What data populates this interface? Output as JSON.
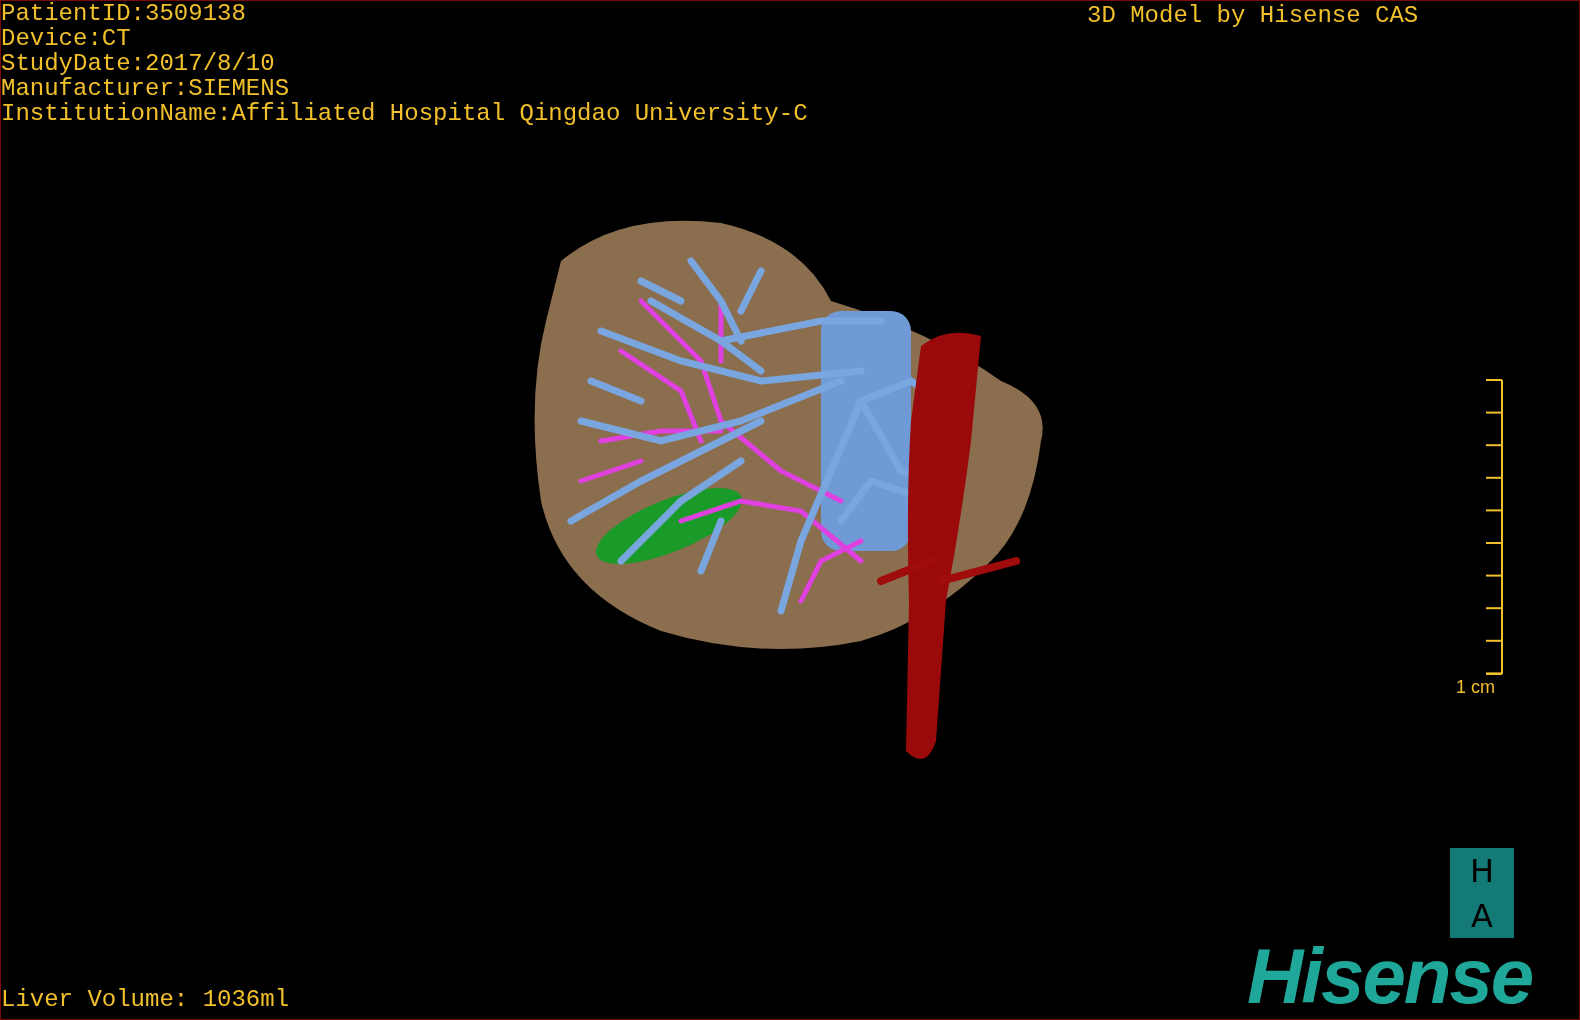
{
  "study_info": [
    "PatientID:3509138",
    "Device:CT",
    "StudyDate:2017/8/10",
    "Manufacturer:SIEMENS",
    "InstitutionName:Affiliated Hospital Qingdao University-C"
  ],
  "credit": "3D Model by Hisense CAS",
  "scale_bar": {
    "label": "1 cm"
  },
  "orientation": [
    "H",
    "A"
  ],
  "logo": "Hisense",
  "measurement": "Liver Volume: 1036ml"
}
